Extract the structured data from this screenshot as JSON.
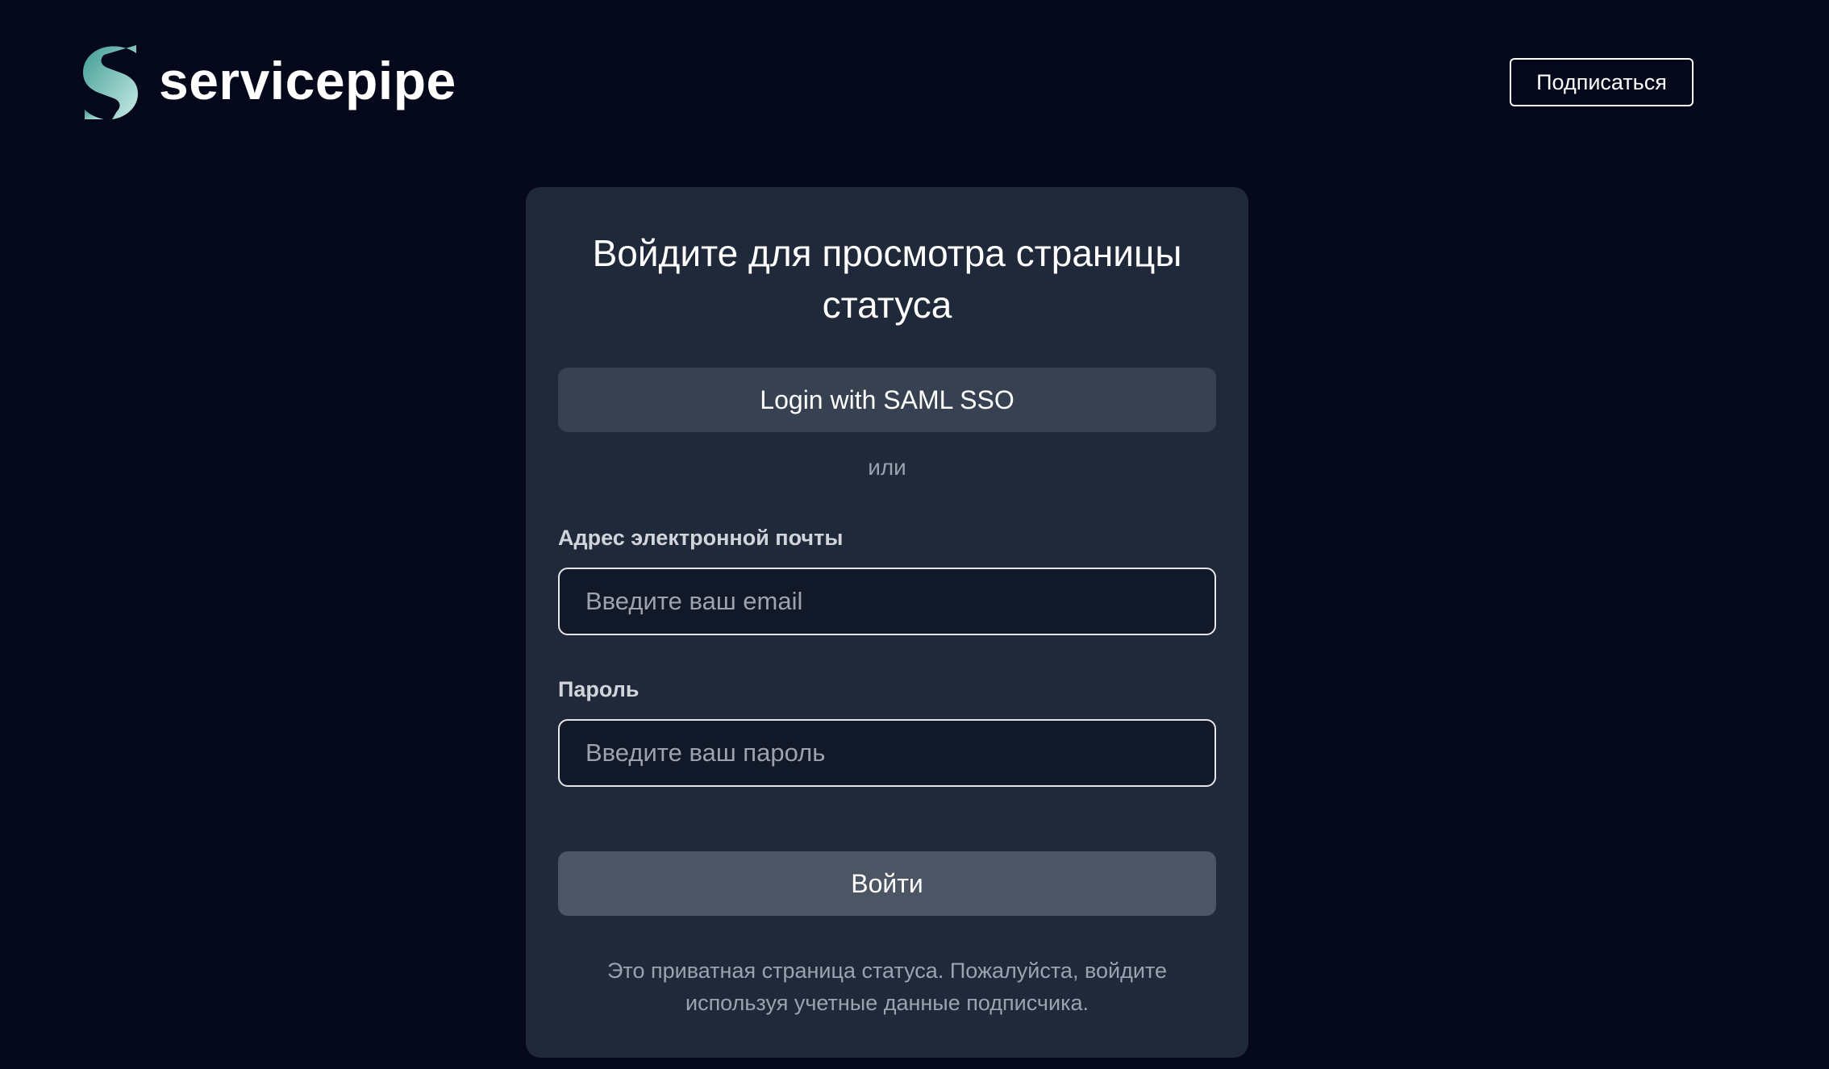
{
  "header": {
    "brand_name": "servicepipe",
    "logo_icon": "servicepipe-logo-icon",
    "subscribe_label": "Подписаться"
  },
  "login_card": {
    "title": "Войдите для просмотра страницы статуса",
    "sso_button_label": "Login with SAML SSO",
    "divider_text": "или",
    "email": {
      "label": "Адрес электронной почты",
      "value": "",
      "placeholder": "Введите ваш email"
    },
    "password": {
      "label": "Пароль",
      "value": "",
      "placeholder": "Введите ваш пароль"
    },
    "submit_label": "Войти",
    "footnote": "Это приватная страница статуса. Пожалуйста, войдите используя учетные данные подписчика."
  },
  "colors": {
    "page_background": "#04081a",
    "card_background": "#1f293a",
    "sso_button": "#374151",
    "submit_button": "#4b5563",
    "input_background": "#111827",
    "logo_gradient_start": "#4fa9a0",
    "logo_gradient_end": "#c8ebe6",
    "muted_text": "#9ca3af"
  }
}
